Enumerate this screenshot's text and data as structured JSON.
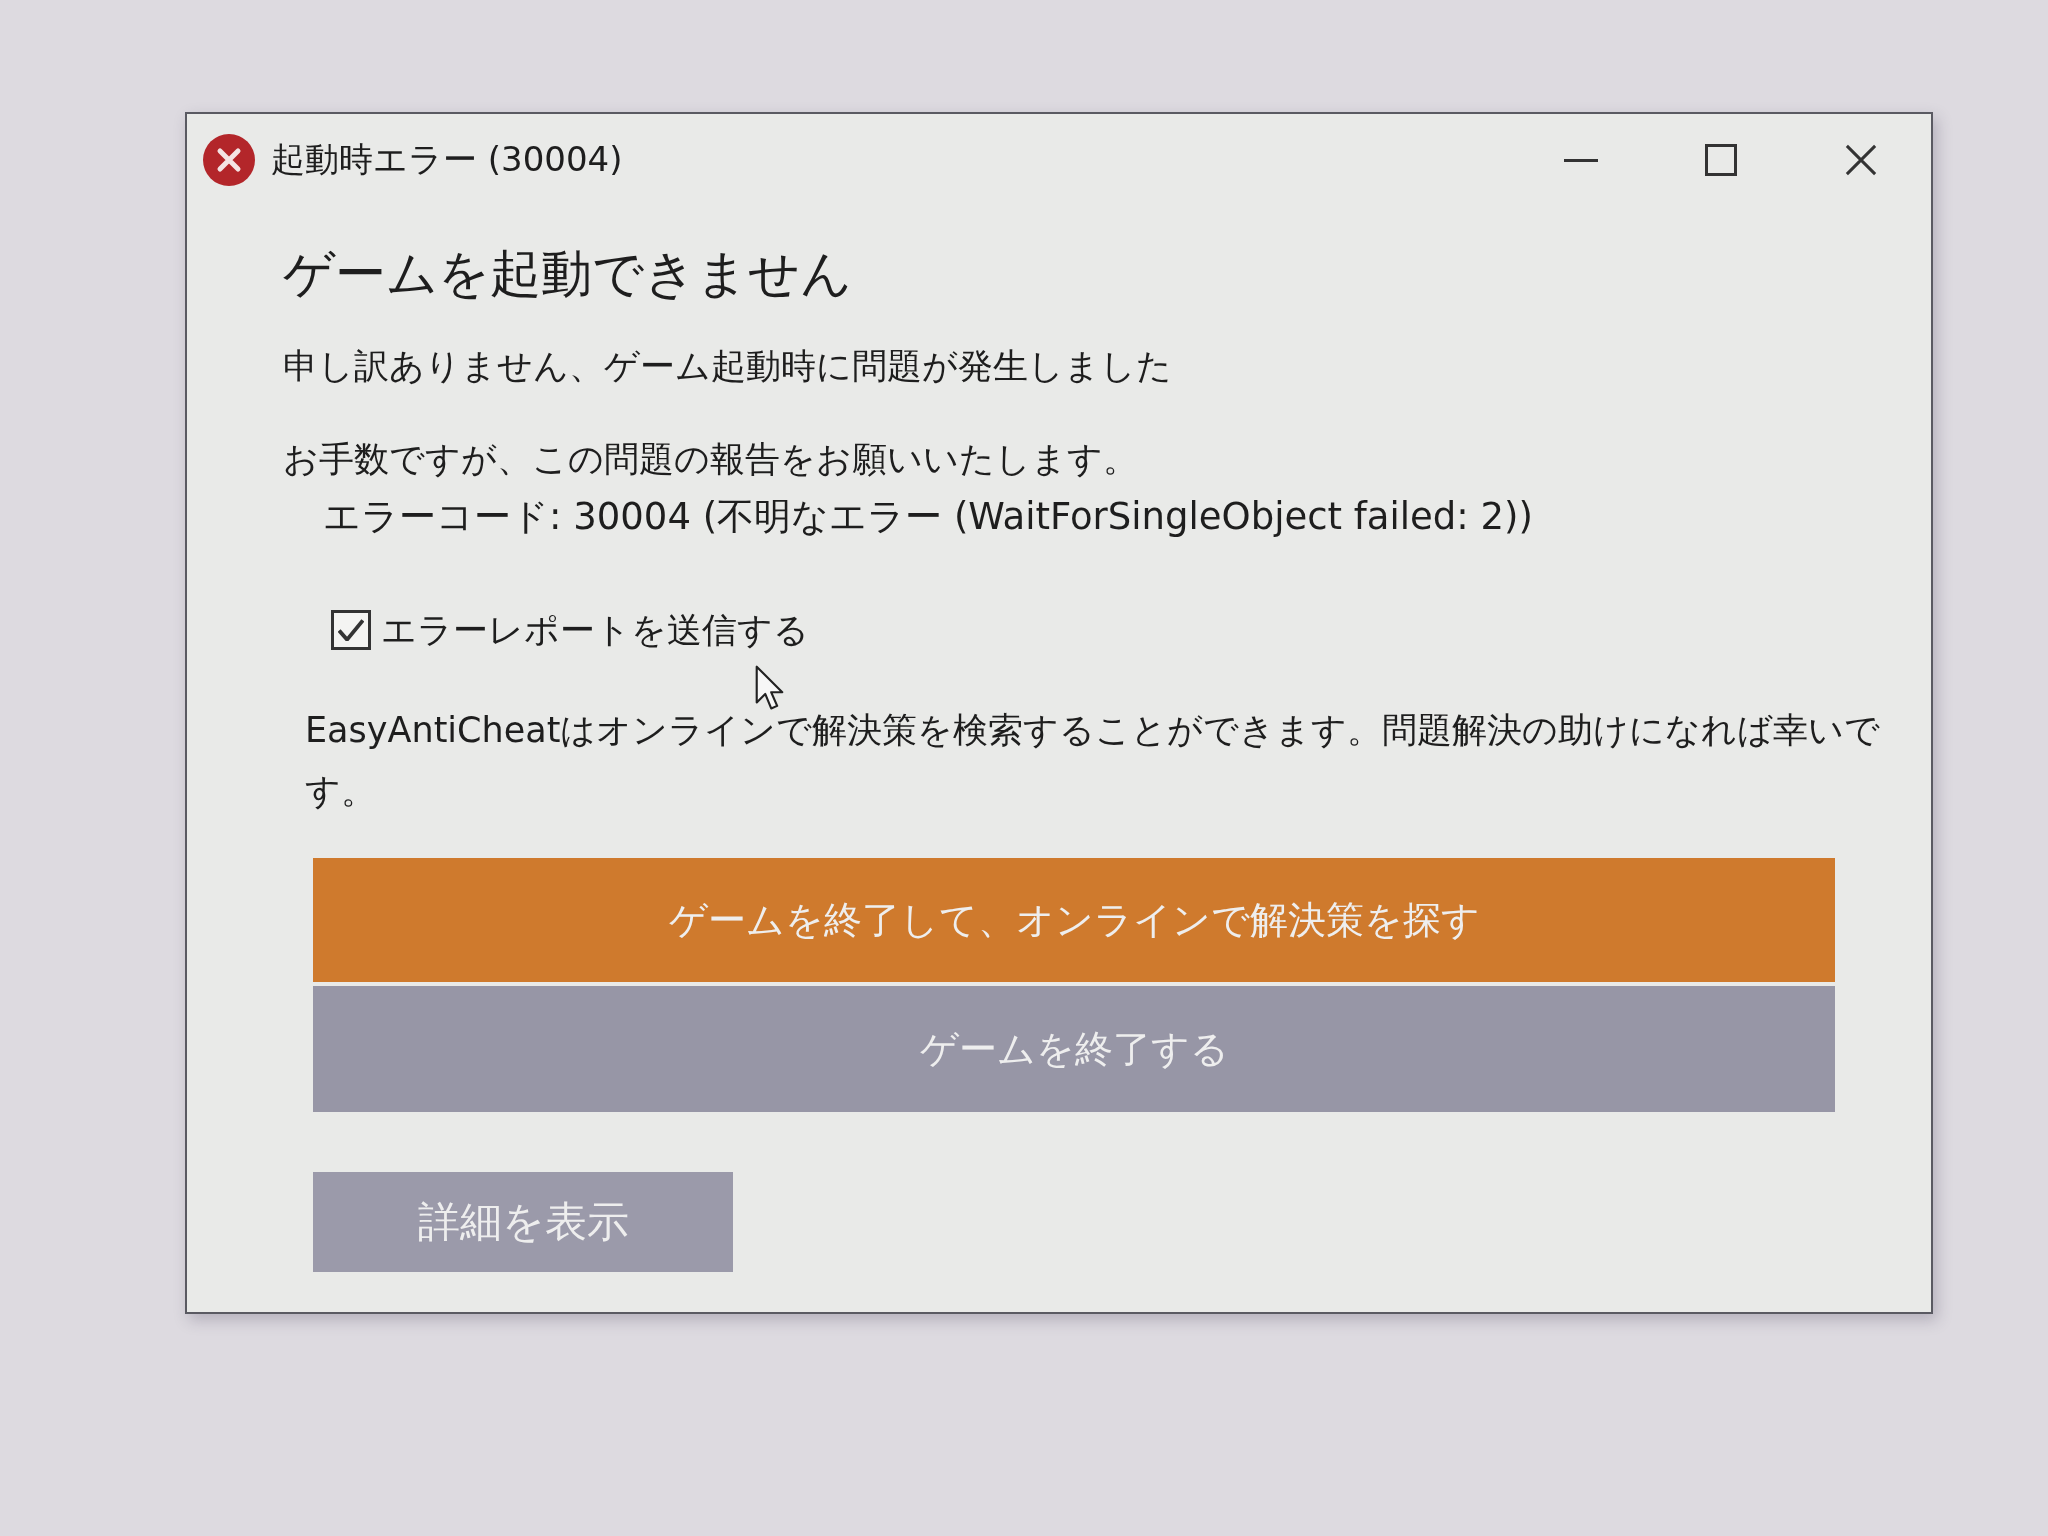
{
  "window": {
    "title": "起動時エラー (30004)"
  },
  "heading": "ゲームを起動できません",
  "message": "申し訳ありません、ゲーム起動時に問題が発生しました",
  "request": "お手数ですが、この問題の報告をお願いいたします。",
  "error_code": "エラーコード: 30004 (不明なエラー (WaitForSingleObject failed: 2))",
  "checkbox": {
    "label": "エラーレポートを送信する",
    "checked": true
  },
  "info": "EasyAntiCheatはオンラインで解決策を検索することができます。問題解決の助けになれば幸いです。",
  "buttons": [
    {
      "label": "ゲームを終了して、オンラインで解決策を探す",
      "kind": "primary"
    },
    {
      "label": "ゲームを終了する",
      "kind": "secondary"
    },
    {
      "label": "詳細を表示",
      "kind": "details"
    }
  ]
}
